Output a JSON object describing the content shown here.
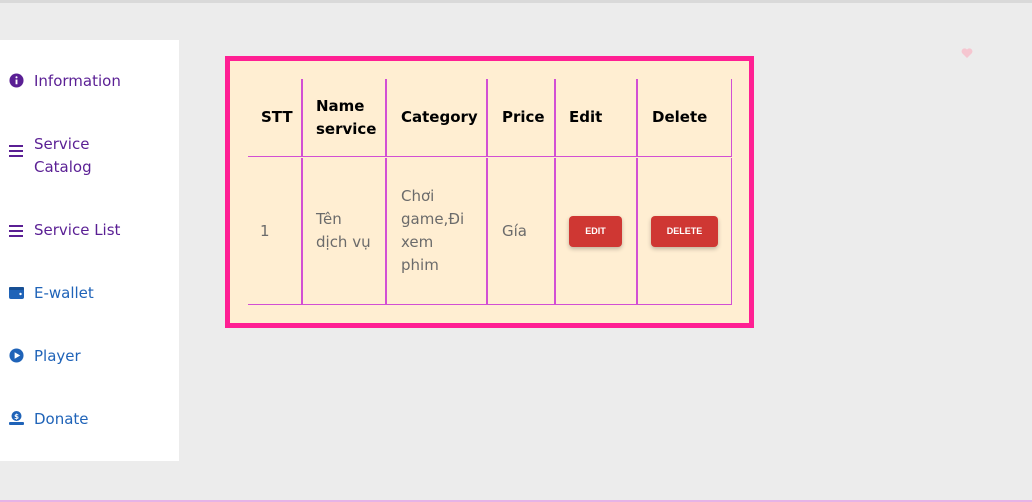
{
  "sidebar": {
    "items": [
      {
        "label": "Information",
        "icon": "info-circle-icon",
        "color": "#5a1f94"
      },
      {
        "label": "Service Catalog",
        "icon": "menu-lines-icon",
        "color": "#5a1f94"
      },
      {
        "label": "Service List",
        "icon": "menu-lines-icon",
        "color": "#5a1f94"
      },
      {
        "label": "E-wallet",
        "icon": "wallet-icon",
        "color": "#1f63b8"
      },
      {
        "label": "Player",
        "icon": "play-circle-icon",
        "color": "#1f63b8"
      },
      {
        "label": "Donate",
        "icon": "donate-icon",
        "color": "#1f63b8"
      }
    ]
  },
  "table": {
    "headers": [
      "STT",
      "Name service",
      "Category",
      "Price",
      "Edit",
      "Delete"
    ],
    "rows": [
      {
        "stt": "1",
        "name": "Tên dịch vụ",
        "category": "Chơi game,Đi xem phim",
        "price": "Gía",
        "edit_label": "EDIT",
        "delete_label": "DELETE"
      }
    ]
  },
  "colors": {
    "frame": "#ff1f93",
    "table_bg": "#ffeed2",
    "button": "#cf3733",
    "grid": "#d24fd4"
  }
}
